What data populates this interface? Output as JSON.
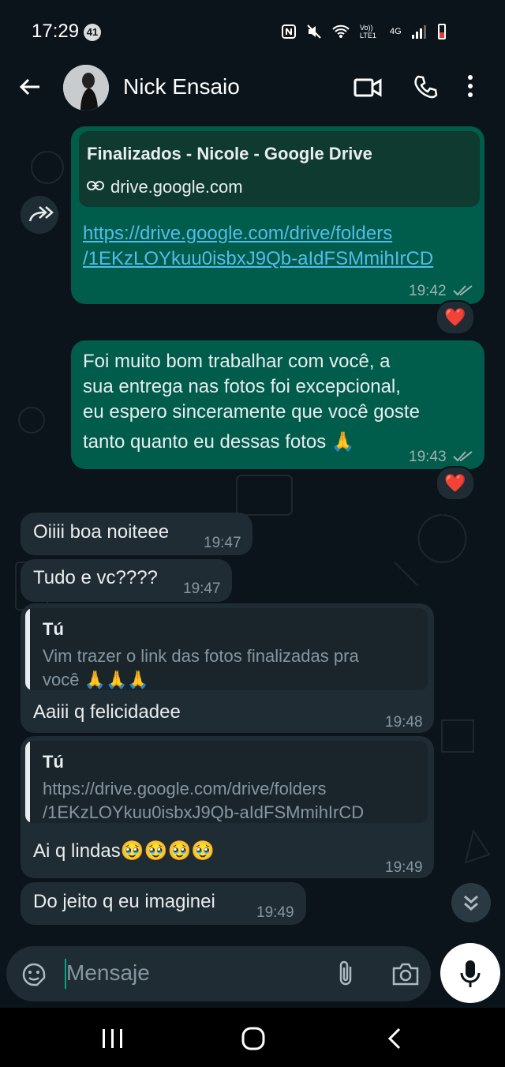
{
  "status_bar": {
    "time": "17:29",
    "badge": "41",
    "network": "Vo)) LTE1",
    "net_type": "4G"
  },
  "header": {
    "contact_name": "Nick Ensaio"
  },
  "messages": [
    {
      "type": "out",
      "link_title": "Finalizados - Nicole - Google Drive",
      "link_domain": "drive.google.com",
      "url_line1": "https://drive.google.com/drive/folders",
      "url_line2": "/1EKzLOYkuu0isbxJ9Qb-aIdFSMmihIrCD",
      "time": "19:42",
      "reaction": "❤️"
    },
    {
      "type": "out",
      "lines": [
        "Foi muito bom trabalhar com você, a",
        "sua entrega nas fotos foi excepcional,",
        "eu espero sinceramente que você goste",
        "tanto quanto eu dessas fotos 🙏"
      ],
      "time": "19:43",
      "reaction": "❤️"
    },
    {
      "type": "in",
      "text": "Oiiii boa noiteee",
      "time": "19:47"
    },
    {
      "type": "in",
      "text": "Tudo e vc????",
      "time": "19:47"
    },
    {
      "type": "in",
      "quote_author": "Tú",
      "quote_lines": [
        "Vim trazer o link das fotos finalizadas pra",
        "você 🙏🙏🙏"
      ],
      "text": "Aaiii q felicidadee",
      "time": "19:48"
    },
    {
      "type": "in",
      "quote_author": "Tú",
      "quote_lines": [
        "https://drive.google.com/drive/folders",
        "/1EKzLOYkuu0isbxJ9Qb-aIdFSMmihIrCD"
      ],
      "text": "Ai q lindas🥹🥹🥹🥹",
      "time": "19:49"
    },
    {
      "type": "in",
      "text": "Do jeito q eu imaginei",
      "time": "19:49"
    }
  ],
  "composer": {
    "placeholder": "Mensaje"
  },
  "colors": {
    "outgoing": "#005c4b",
    "incoming": "#202c33",
    "accent": "#00a884",
    "link": "#53bdeb"
  }
}
